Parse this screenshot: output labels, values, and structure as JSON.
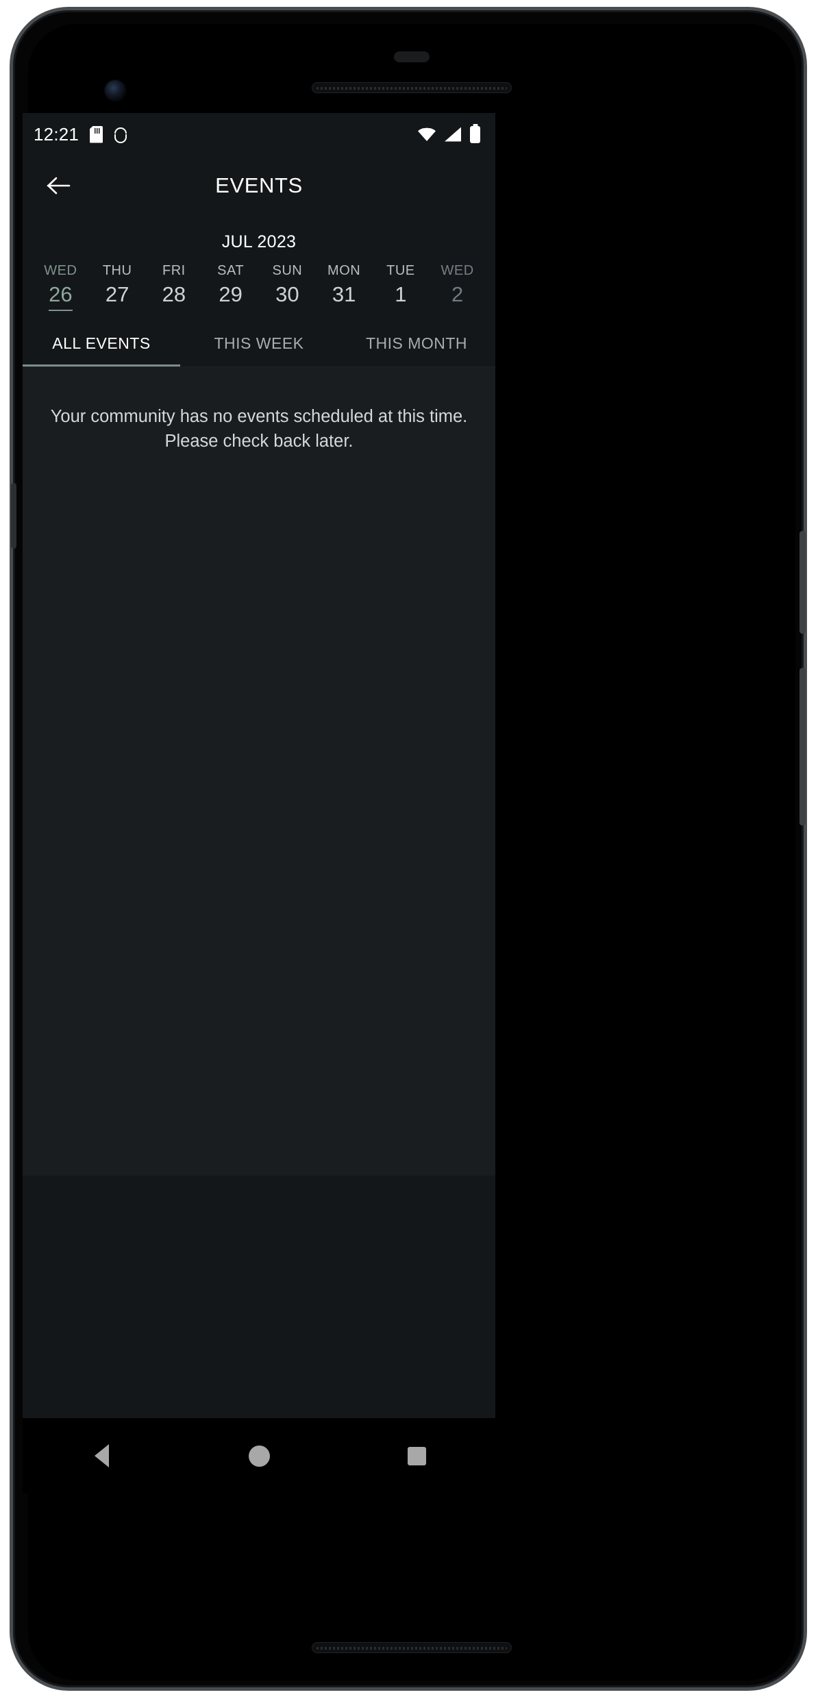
{
  "status_bar": {
    "clock": "12:21",
    "left_icons": [
      "sd-card-icon",
      "android-debug-icon"
    ],
    "right_icons": [
      "wifi-icon",
      "cellular-signal-icon",
      "battery-icon"
    ]
  },
  "app_bar": {
    "back_icon": "back-arrow-icon",
    "title": "EVENTS"
  },
  "calendar": {
    "month_label": "JUL 2023",
    "days": [
      {
        "dow": "WED",
        "num": "26",
        "state": "today"
      },
      {
        "dow": "THU",
        "num": "27",
        "state": "normal"
      },
      {
        "dow": "FRI",
        "num": "28",
        "state": "normal"
      },
      {
        "dow": "SAT",
        "num": "29",
        "state": "normal"
      },
      {
        "dow": "SUN",
        "num": "30",
        "state": "normal"
      },
      {
        "dow": "MON",
        "num": "31",
        "state": "normal"
      },
      {
        "dow": "TUE",
        "num": "1",
        "state": "normal"
      },
      {
        "dow": "WED",
        "num": "2",
        "state": "faded"
      }
    ]
  },
  "tabs": {
    "active_index": 0,
    "items": [
      {
        "label": "ALL EVENTS"
      },
      {
        "label": "THIS WEEK"
      },
      {
        "label": "THIS MONTH"
      }
    ]
  },
  "content": {
    "empty_message": "Your community has no events scheduled at this time. Please check back later."
  },
  "nav_bar": {
    "back_label": "back-nav-button",
    "home_label": "home-nav-button",
    "recents_label": "recents-nav-button"
  },
  "colors": {
    "screen_background": "#141719",
    "content_background": "#1a1d1f",
    "accent": "#7b8f88",
    "text_primary": "#ffffff",
    "text_secondary": "#a9adae",
    "text_faded": "#6f7b84"
  }
}
